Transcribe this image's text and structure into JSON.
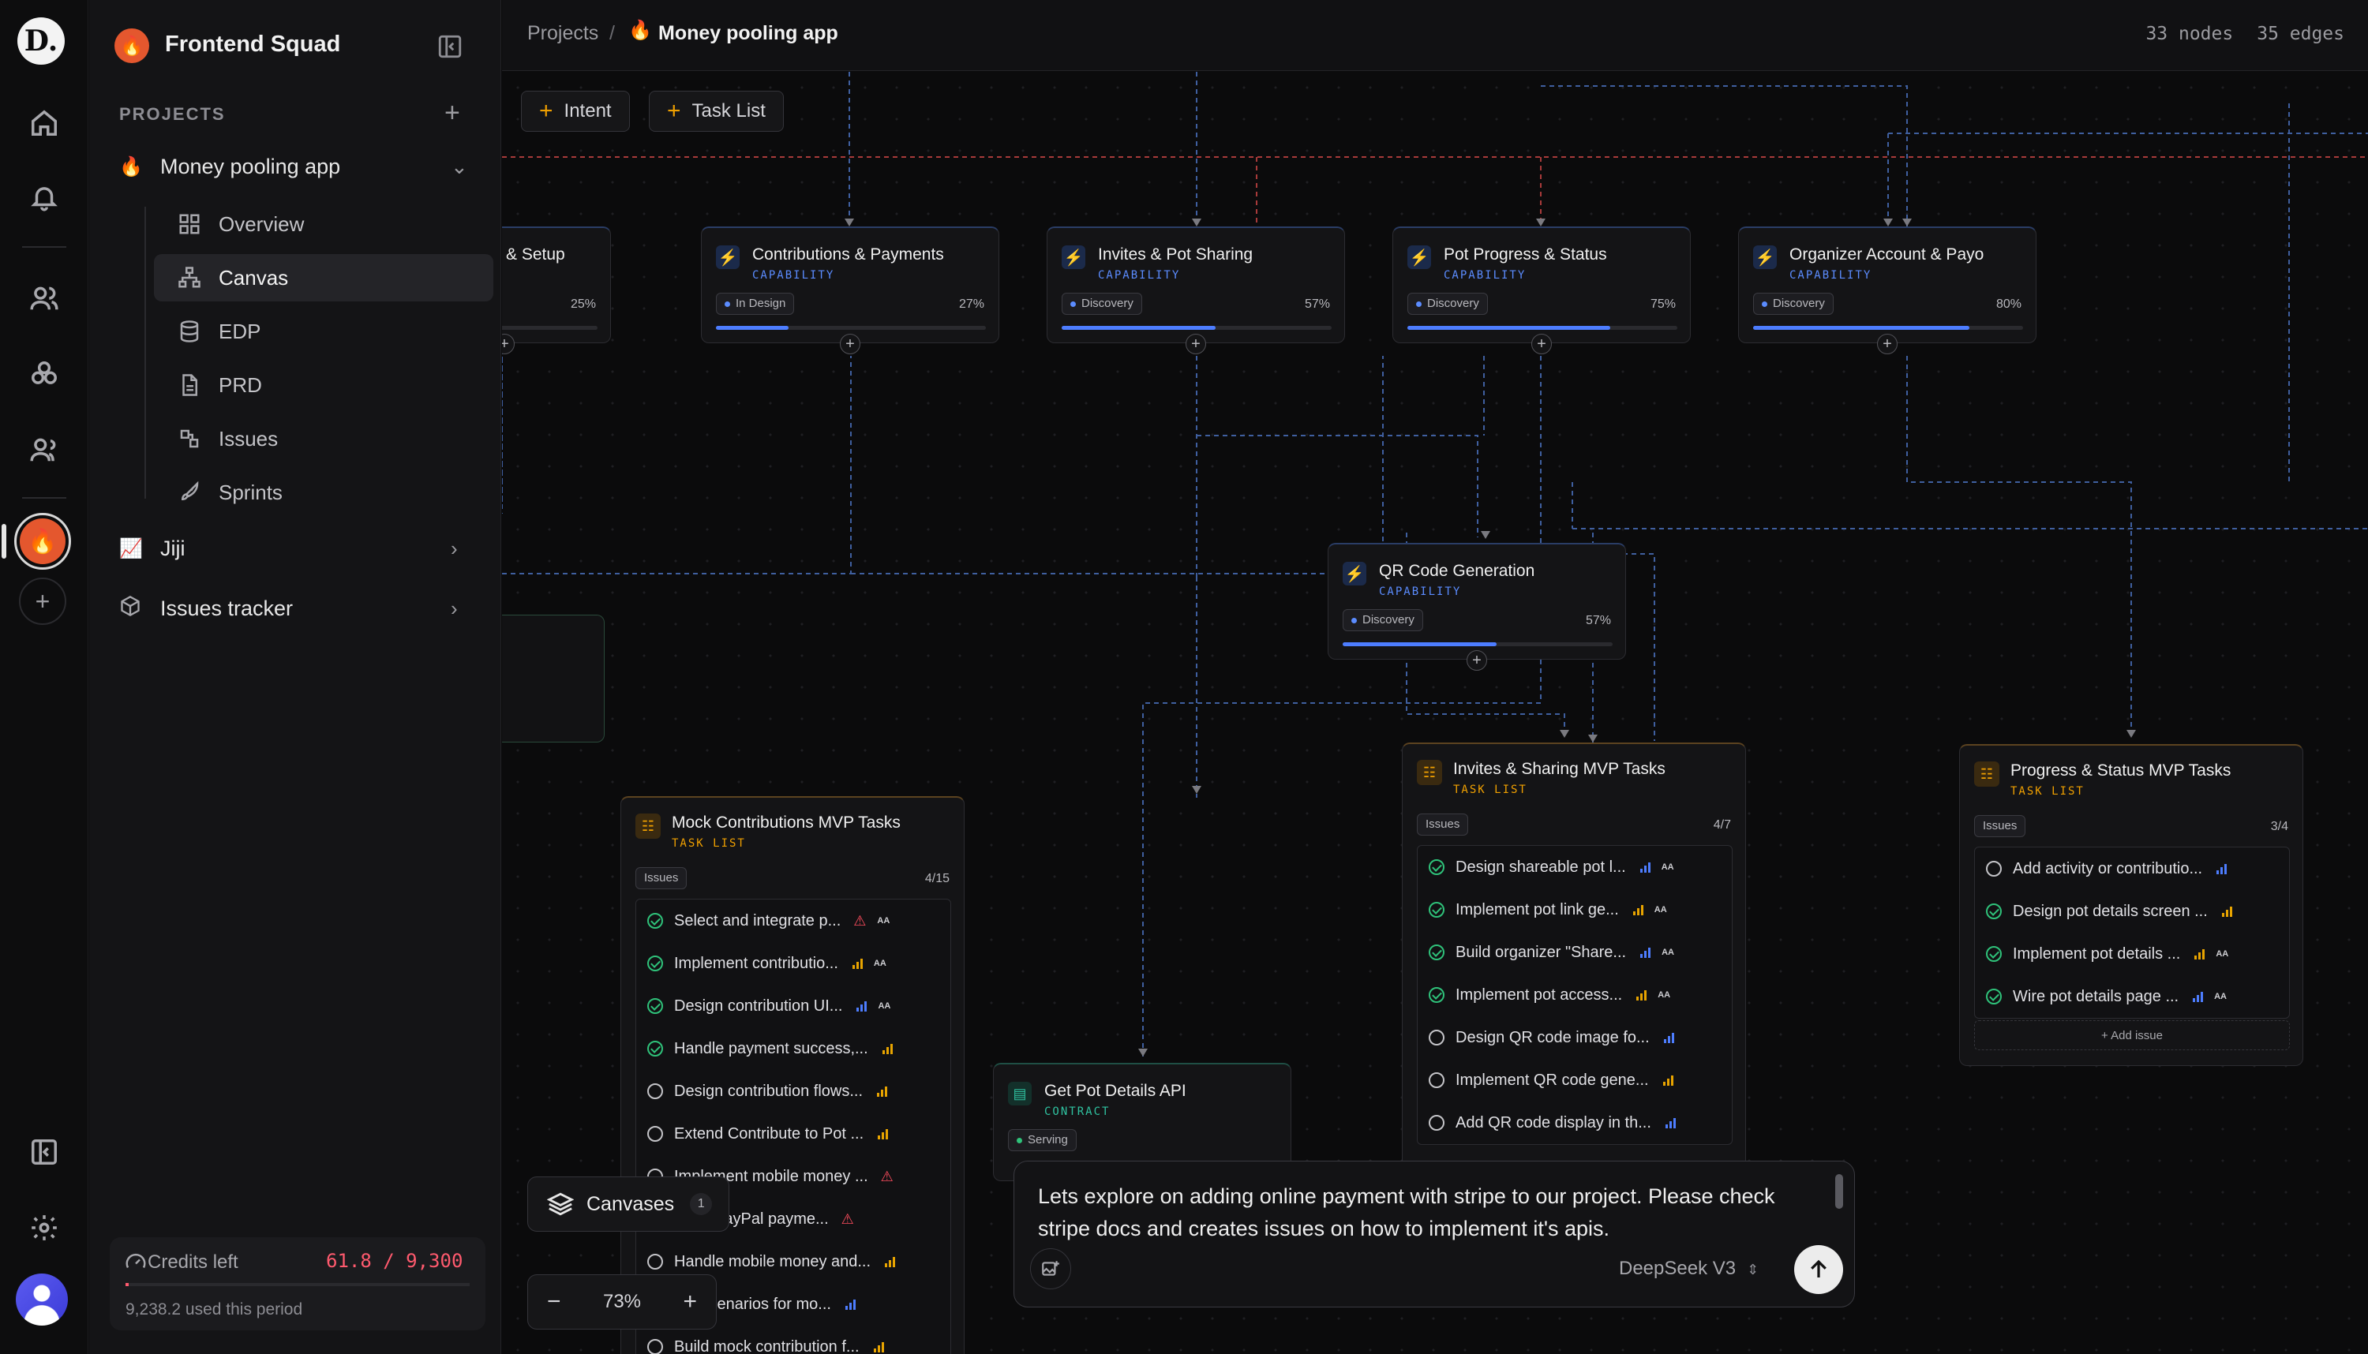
{
  "rail": {
    "logo": "D.",
    "icons": [
      "home-icon",
      "bell-icon",
      "users-icon",
      "network-icon",
      "team-icon",
      "fire-icon",
      "plus-icon",
      "sidebar-toggle-icon",
      "settings-icon",
      "avatar"
    ]
  },
  "sidebar": {
    "team_name": "Frontend Squad",
    "projects_label": "PROJECTS",
    "projects": [
      {
        "label": "Money pooling app",
        "icon": "🔥",
        "expanded": true
      },
      {
        "label": "Jiji",
        "icon": "📈",
        "expanded": false
      },
      {
        "label": "Issues tracker",
        "icon": "box-icon",
        "expanded": false
      }
    ],
    "sub_items": [
      {
        "label": "Overview",
        "icon": "grid-icon"
      },
      {
        "label": "Canvas",
        "icon": "canvas-icon",
        "active": true
      },
      {
        "label": "EDP",
        "icon": "database-icon"
      },
      {
        "label": "PRD",
        "icon": "document-icon"
      },
      {
        "label": "Issues",
        "icon": "issues-icon"
      },
      {
        "label": "Sprints",
        "icon": "rocket-icon"
      }
    ],
    "credits": {
      "label": "Credits left",
      "value": "61.8 / 9,300",
      "used": "9,238.2 used this period",
      "fraction": 0.0066
    }
  },
  "topbar": {
    "breadcrumb_root": "Projects",
    "breadcrumb_sep": "/",
    "breadcrumb_icon": "🔥",
    "breadcrumb_current": "Money pooling app",
    "nodes": "33 nodes",
    "edges": "35 edges"
  },
  "toolbar": {
    "intent_label": "Intent",
    "task_list_label": "Task List"
  },
  "capabilities": [
    {
      "title": "& Setup",
      "kind": "",
      "status": "",
      "percent": "25%",
      "progress": 0.25
    },
    {
      "title": "Contributions & Payments",
      "kind": "CAPABILITY",
      "status": "In Design",
      "percent": "27%",
      "progress": 0.27
    },
    {
      "title": "Invites & Pot Sharing",
      "kind": "CAPABILITY",
      "status": "Discovery",
      "percent": "57%",
      "progress": 0.57
    },
    {
      "title": "Pot Progress & Status",
      "kind": "CAPABILITY",
      "status": "Discovery",
      "percent": "75%",
      "progress": 0.75
    },
    {
      "title": "Organizer Account & Payo",
      "kind": "CAPABILITY",
      "status": "Discovery",
      "percent": "80%",
      "progress": 0.8
    },
    {
      "title": "QR Code Generation",
      "kind": "CAPABILITY",
      "status": "Discovery",
      "percent": "57%",
      "progress": 0.57
    }
  ],
  "task_lists": [
    {
      "title": "Mock Contributions MVP Tasks",
      "kind": "TASK LIST",
      "tag": "Issues",
      "count": "4/15",
      "items": [
        {
          "label": "Select and integrate p...",
          "done": true,
          "flag": "warn",
          "aa": true
        },
        {
          "label": "Implement contributio...",
          "done": true,
          "priority": "high",
          "aa": true
        },
        {
          "label": "Design contribution UI...",
          "done": true,
          "priority": "low",
          "aa": true
        },
        {
          "label": "Handle payment success,...",
          "done": true,
          "priority": "high"
        },
        {
          "label": "Design contribution flows...",
          "done": false,
          "priority": "high"
        },
        {
          "label": "Extend Contribute to Pot ...",
          "done": false,
          "priority": "high"
        },
        {
          "label": "Implement mobile money ...",
          "done": false,
          "flag": "warn"
        },
        {
          "label": "...ent PayPal payme...",
          "done": false,
          "flag": "warn"
        },
        {
          "label": "Handle mobile money and...",
          "done": false,
          "priority": "high"
        },
        {
          "label": "...A scenarios for mo...",
          "done": false,
          "priority": "low"
        },
        {
          "label": "Build mock contribution f...",
          "done": false,
          "priority": "high"
        }
      ]
    },
    {
      "title": "Invites & Sharing MVP Tasks",
      "kind": "TASK LIST",
      "tag": "Issues",
      "count": "4/7",
      "items": [
        {
          "label": "Design shareable pot l...",
          "done": true,
          "priority": "low",
          "aa": true
        },
        {
          "label": "Implement pot link ge...",
          "done": true,
          "priority": "high",
          "aa": true
        },
        {
          "label": "Build organizer \"Share...",
          "done": true,
          "priority": "low",
          "aa": true
        },
        {
          "label": "Implement pot access...",
          "done": true,
          "priority": "high",
          "aa": true
        },
        {
          "label": "Design QR code image fo...",
          "done": false,
          "priority": "low"
        },
        {
          "label": "Implement QR code gene...",
          "done": false,
          "priority": "high"
        },
        {
          "label": "Add QR code display in th...",
          "done": false,
          "priority": "low"
        }
      ]
    },
    {
      "title": "Progress & Status MVP Tasks",
      "kind": "TASK LIST",
      "tag": "Issues",
      "count": "3/4",
      "add_issue": "+ Add issue",
      "items": [
        {
          "label": "Add activity or contributio...",
          "done": false,
          "priority": "low"
        },
        {
          "label": "Design pot details screen ...",
          "done": true,
          "priority": "high"
        },
        {
          "label": "Implement pot details ...",
          "done": true,
          "priority": "high",
          "aa": true
        },
        {
          "label": "Wire pot details page ...",
          "done": true,
          "priority": "low",
          "aa": true
        }
      ]
    }
  ],
  "contract": {
    "title": "Get Pot Details API",
    "kind": "CONTRACT",
    "status": "Serving"
  },
  "canvases": {
    "label": "Canvases",
    "count": "1"
  },
  "zoom": {
    "minus": "−",
    "value": "73%",
    "plus": "+"
  },
  "chat": {
    "message": "Lets explore on adding online payment with stripe to our project. Please check stripe docs and creates issues on how to implement it's apis.",
    "model": "DeepSeek V3"
  },
  "colors": {
    "accent": "#4d7dff",
    "task": "#f0a000",
    "success": "#2fc27a",
    "danger": "#ff4d5e",
    "wire_blue": "#3f5f9f",
    "wire_red": "#a83a3a"
  }
}
